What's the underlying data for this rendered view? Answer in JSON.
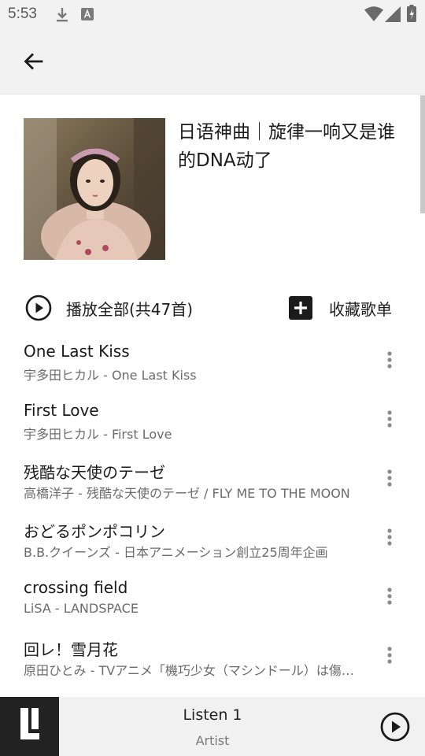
{
  "status_bar": {
    "time": "5:53",
    "left_icons": [
      "download-icon",
      "a-box-icon"
    ],
    "right_icons": [
      "wifi-icon",
      "cell-signal-icon",
      "battery-charging-icon"
    ]
  },
  "app_bar": {
    "back_icon": "arrow-back-icon"
  },
  "playlist": {
    "title": "日语神曲｜旋律一响又是谁的DNA动了",
    "cover_icon": "playlist-cover"
  },
  "actions": {
    "play_all_label": "播放全部(共47首)",
    "play_all_icon": "play-circle-icon",
    "collect_label": "收藏歌单",
    "collect_icon": "add-box-icon"
  },
  "songs": [
    {
      "title": "One Last Kiss",
      "subtitle": "宇多田ヒカル - One Last Kiss"
    },
    {
      "title": "First Love",
      "subtitle": "宇多田ヒカル - First Love"
    },
    {
      "title": "残酷な天使のテーゼ",
      "subtitle": "高橋洋子 - 残酷な天使のテーゼ / FLY ME TO THE MOON"
    },
    {
      "title": "おどるポンポコリン",
      "subtitle": "B.B.クイーンズ - 日本アニメーション創立25周年企画"
    },
    {
      "title": "crossing field",
      "subtitle": "LiSA - LANDSPACE"
    },
    {
      "title": "回レ！雪月花",
      "subtitle": "原田ひとみ - TVアニメ「機巧少女（マシンドール）は傷つかない」"
    }
  ],
  "mini_player": {
    "title": "Listen 1",
    "artist": "Artist",
    "logo_icon": "listen1-logo",
    "play_icon": "play-circle-icon"
  },
  "colors": {
    "bar_background": "#f2f2f2",
    "primary_text": "#1b1b1b",
    "secondary_text": "#6b6b6b",
    "logo_background": "#222222"
  }
}
